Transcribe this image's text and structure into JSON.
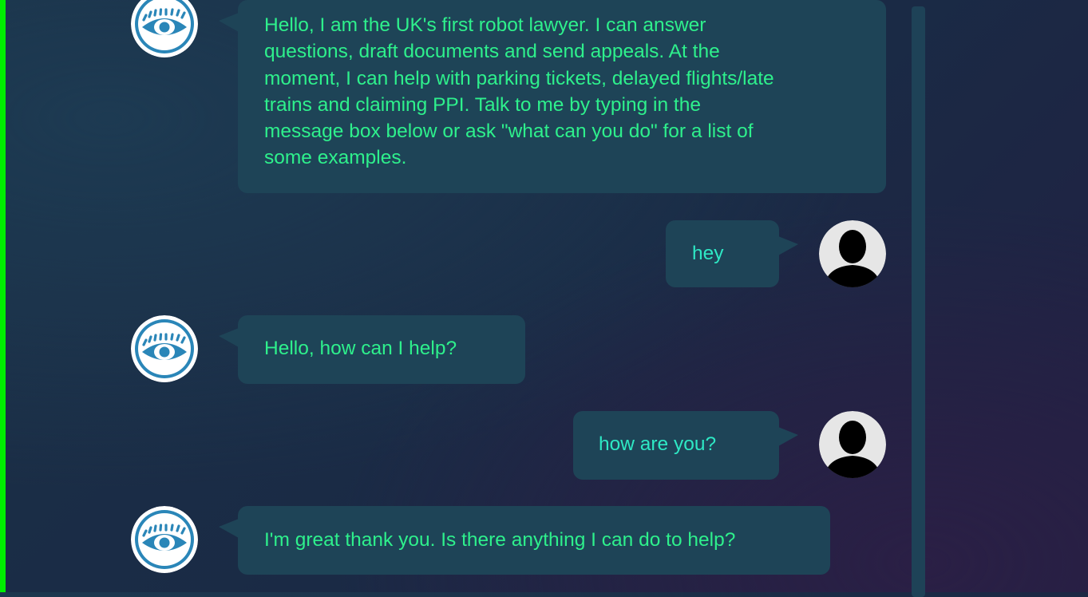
{
  "colors": {
    "background": "#1b2d45",
    "bubble": "#1e4457",
    "bot_text": "#2ef08c",
    "user_text": "#2ee8c4",
    "accent_stripe": "#00ee00",
    "bot_avatar": "#2a86b8"
  },
  "chat": {
    "messages": [
      {
        "sender": "bot",
        "avatar_icon": "eye-icon",
        "lines": [
          "Hello, I am the UK's first robot lawyer. I can answer",
          "questions, draft documents and send appeals. At the",
          "moment, I can help with parking tickets, delayed flights/late",
          "trains and claiming PPI. Talk to me by typing in the",
          "message box below or ask \"what can you do\" for a list of",
          "some examples."
        ]
      },
      {
        "sender": "user",
        "avatar_icon": "user-silhouette-icon",
        "text": "hey"
      },
      {
        "sender": "bot",
        "avatar_icon": "eye-icon",
        "text": "Hello, how can I help?"
      },
      {
        "sender": "user",
        "avatar_icon": "user-silhouette-icon",
        "text": "how are you?"
      },
      {
        "sender": "bot",
        "avatar_icon": "eye-icon",
        "text": "I'm great thank you. Is there anything I can do to help?"
      }
    ]
  }
}
